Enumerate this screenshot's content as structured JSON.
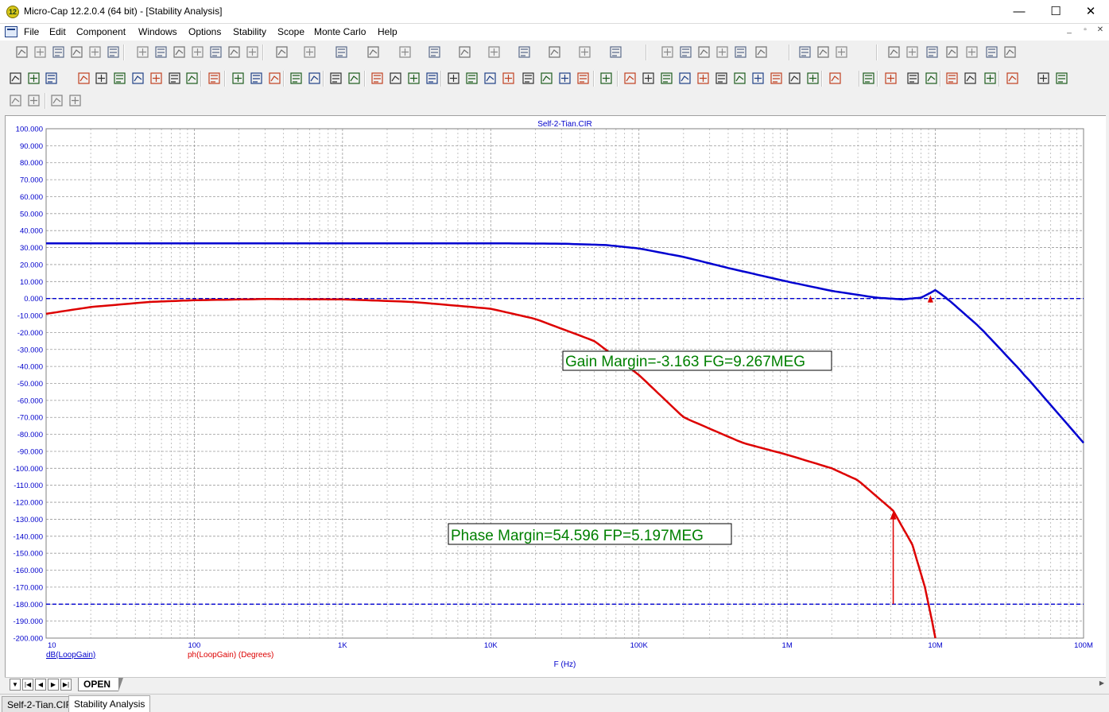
{
  "window": {
    "app_icon": "12",
    "title": "Micro-Cap 12.2.0.4 (64 bit) - [Stability Analysis]",
    "controls": {
      "minimize": "—",
      "maximize": "☐",
      "close": "✕"
    }
  },
  "menu": {
    "items": [
      "File",
      "Edit",
      "Component",
      "Windows",
      "Options",
      "Stability",
      "Scope",
      "Monte Carlo",
      "Help"
    ],
    "mdi_controls": [
      "_",
      "▫",
      "✕"
    ]
  },
  "plot": {
    "title": "Self-2-Tian.CIR",
    "xlabel": "F (Hz)",
    "legend_left": "dB(LoopGain)",
    "legend_right": "ph(LoopGain) (Degrees)",
    "gain_margin_label": "Gain Margin=-3.163 FG=9.267MEG",
    "phase_margin_label": "Phase Margin=54.596 FP=5.197MEG",
    "colors": {
      "gain": "#0000d0",
      "phase": "#dd0000",
      "axis_text": "#0000cc",
      "label_text": "#008000"
    }
  },
  "chart_data": {
    "type": "line",
    "title": "Self-2-Tian.CIR",
    "xlabel": "F (Hz)",
    "x_scale": "log",
    "xlim": [
      10,
      100000000
    ],
    "ylim": [
      -200,
      100
    ],
    "x_ticks": [
      "10",
      "100",
      "1K",
      "10K",
      "100K",
      "1M",
      "10M",
      "100M"
    ],
    "y_ticks": [
      "100.000",
      "90.000",
      "80.000",
      "70.000",
      "60.000",
      "50.000",
      "40.000",
      "30.000",
      "20.000",
      "10.000",
      "0.000",
      "-10.000",
      "-20.000",
      "-30.000",
      "-40.000",
      "-50.000",
      "-60.000",
      "-70.000",
      "-80.000",
      "-90.000",
      "-100.000",
      "-110.000",
      "-120.000",
      "-130.000",
      "-140.000",
      "-150.000",
      "-160.000",
      "-170.000",
      "-180.000",
      "-190.000",
      "-200.000"
    ],
    "grid": true,
    "series": [
      {
        "name": "dB(LoopGain)",
        "color": "#0000d0",
        "x": [
          10,
          100,
          1000,
          10000,
          30000,
          60000,
          100000,
          200000,
          400000,
          1000000,
          2000000,
          4000000,
          6000000,
          8000000,
          9200000,
          10000000,
          12000000,
          20000000,
          40000000,
          100000000
        ],
        "y": [
          32.5,
          32.5,
          32.5,
          32.5,
          32.3,
          31.5,
          29.5,
          24.5,
          18.0,
          10.0,
          4.5,
          0.5,
          -0.5,
          0.5,
          3.2,
          5.0,
          0.0,
          -17.0,
          -45.0,
          -85.0
        ]
      },
      {
        "name": "ph(LoopGain) (Degrees)",
        "color": "#dd0000",
        "x": [
          10,
          20,
          50,
          100,
          300,
          1000,
          3000,
          10000,
          20000,
          50000,
          100000,
          200000,
          500000,
          1000000,
          2000000,
          3000000,
          5197000,
          7000000,
          8500000,
          9500000,
          10000000
        ],
        "y": [
          -9.0,
          -5.0,
          -2.0,
          -1.0,
          -0.3,
          -0.5,
          -2.0,
          -6.0,
          -12.0,
          -25.0,
          -45.0,
          -70.0,
          -85.0,
          -92.0,
          -100.0,
          -107.0,
          -125.0,
          -145.0,
          -170.0,
          -190.0,
          -200.0
        ]
      },
      {
        "name": "",
        "color": "#0000d0",
        "x": [
          10,
          100000000
        ],
        "y": [
          0,
          0
        ]
      },
      {
        "name": "",
        "color": "#0000d0",
        "x": [
          10,
          100000000
        ],
        "y": [
          -180,
          -180
        ]
      }
    ],
    "annotations": [
      {
        "text": "Gain Margin=-3.163 FG=9.267MEG",
        "x": 9267000,
        "y": 0
      },
      {
        "text": "Phase Margin=54.596 FP=5.197MEG",
        "x": 5197000,
        "y": -125.4
      }
    ]
  },
  "bottom": {
    "nav_buttons": [
      "▼",
      "|◀",
      "◀",
      "▶",
      "▶|"
    ],
    "sheet_tab": "OPEN",
    "doc_tabs": [
      "Self-2-Tian.CIR",
      "Stability Analysis"
    ]
  }
}
